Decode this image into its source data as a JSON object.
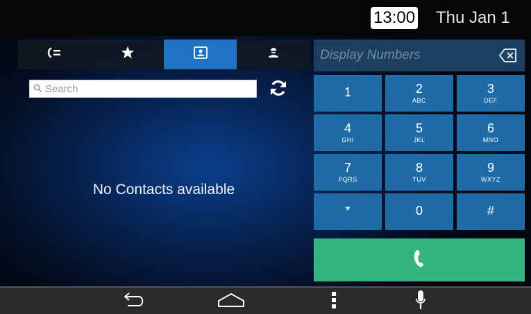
{
  "status": {
    "time": "13:00",
    "date": "Thu Jan 1"
  },
  "tabs": [
    {
      "name": "recent-calls",
      "icon": "recent-calls-icon",
      "active": false
    },
    {
      "name": "favorites",
      "icon": "star-icon",
      "active": false
    },
    {
      "name": "contacts",
      "icon": "contacts-icon",
      "active": true
    },
    {
      "name": "voicemail",
      "icon": "person-icon",
      "active": false
    }
  ],
  "search": {
    "placeholder": "Search"
  },
  "contacts": {
    "empty_message": "No Contacts available"
  },
  "dialpad": {
    "display_placeholder": "Display Numbers",
    "keys": [
      {
        "digit": "1",
        "letters": ""
      },
      {
        "digit": "2",
        "letters": "ABC"
      },
      {
        "digit": "3",
        "letters": "DEF"
      },
      {
        "digit": "4",
        "letters": "GHI"
      },
      {
        "digit": "5",
        "letters": "JKL"
      },
      {
        "digit": "6",
        "letters": "MNO"
      },
      {
        "digit": "7",
        "letters": "PQRS"
      },
      {
        "digit": "8",
        "letters": "TUV"
      },
      {
        "digit": "9",
        "letters": "WXYZ"
      },
      {
        "digit": "*",
        "letters": ""
      },
      {
        "digit": "0",
        "letters": ""
      },
      {
        "digit": "#",
        "letters": ""
      }
    ]
  },
  "icons": {
    "back": "back-icon",
    "home": "home-icon",
    "menu": "menu-icon",
    "mic": "microphone-icon",
    "call": "phone-icon",
    "backspace": "backspace-icon",
    "refresh": "refresh-icon",
    "search": "search-icon"
  },
  "colors": {
    "accent_tab": "#1f72c4",
    "key": "#1f6ba5",
    "call": "#33b57d",
    "display": "#1c3f60"
  }
}
